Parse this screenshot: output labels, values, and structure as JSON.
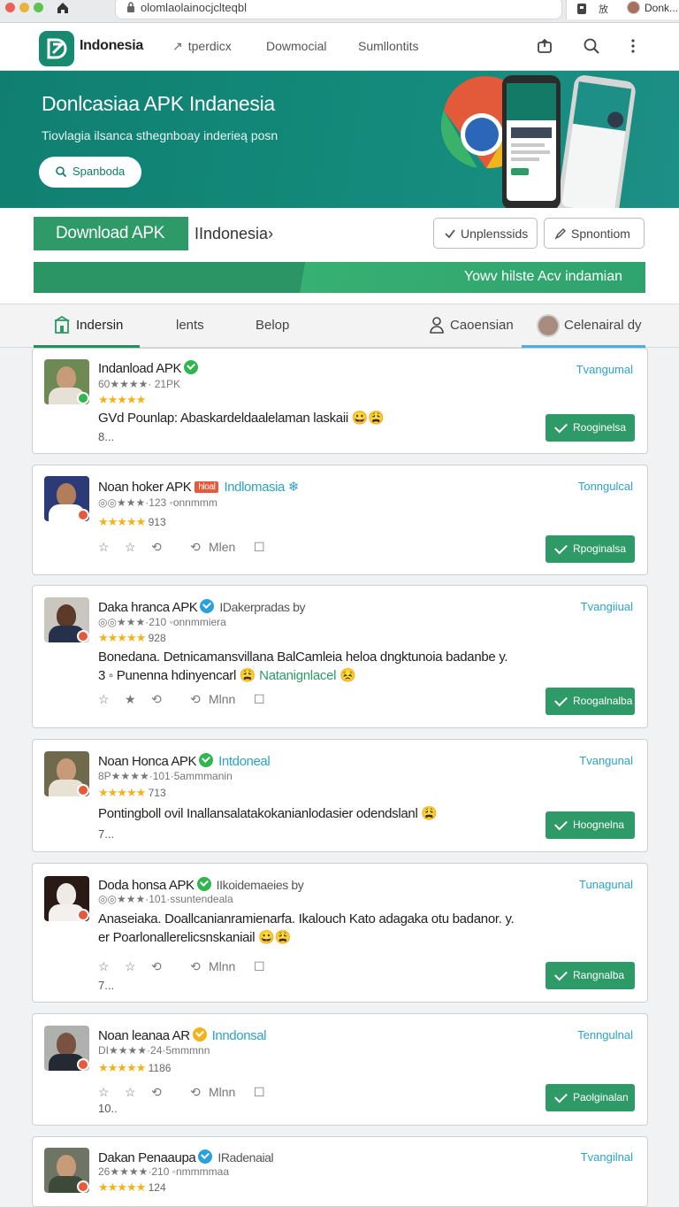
{
  "browser": {
    "url": "olomlaolainocjclteqbl",
    "profile_name": "Donk..."
  },
  "header": {
    "brand": "Indonesia",
    "nav": [
      "tperdicx",
      "Dowmocial",
      "Sumllontits"
    ]
  },
  "hero": {
    "title": "Donlcasiaa APK Indanesia",
    "subtitle": "Tiovlagia ilsanca sthegnboay inderieą posn",
    "search_label": "Spanboda"
  },
  "download": {
    "button_label": "Download APK",
    "region_label": "IIndonesia›",
    "pill_1": "Unplenssids",
    "pill_2": "Spnontiom",
    "promo_text": "Yowv hilste Acv indamian"
  },
  "tabs": [
    "Indersin",
    "lents",
    "Belop",
    "Caoensian",
    "Celenairal dy"
  ],
  "cards": [
    {
      "title": "Indanload APK",
      "meta": "60★★★★· 21PK",
      "rating_stars": "★★★★★",
      "desc": "GVd Pounlap: Abaskardeldaalelaman laskaii 😀😩",
      "small": "8...",
      "status": "Tvangumal",
      "button": "Rooginelsa"
    },
    {
      "title": "Noan hoker APK",
      "tag": "hloal",
      "link": "Indlomasia ❄",
      "meta": "◎◎★★★·123 ◦onnmmm",
      "rating_stars": "★★★★★",
      "rating_value": "913",
      "actions": [
        "☆",
        "☆",
        "⟲",
        "⟲",
        "Mlen",
        "☐"
      ],
      "status": "Tonngulcal",
      "button": "Rpoginalsa"
    },
    {
      "title": "Daka hranca APK",
      "muted": "IDakerpradas by",
      "meta": "◎◎★★★·210 ◦onnmmiera",
      "rating_stars": "★★★★★",
      "rating_value": "928",
      "desc": "Bonedana. Detnicamansvillana BalCamleia heloa dngktunoia badanbe y.",
      "desc2": "3 ◦ Punenna hdinyencarl 😩",
      "desc2_link": "Natanignlacel 😣",
      "actions": [
        "☆",
        "★",
        "⟲",
        "⟲",
        "Mlnn",
        "☐"
      ],
      "status": "Tvangiiual",
      "button": "Roogalnalba"
    },
    {
      "title": "Noan Honca APK",
      "link": "Intdoneal",
      "meta": "8P★★★★·101·5ammmanin",
      "rating_stars": "★★★★★",
      "rating_value": "713",
      "desc": "Pontingboll ovil Inallansalatakokanianlodasier odendslanl 😩",
      "small": "7...",
      "status": "Tvangunal",
      "button": "Hoognelna"
    },
    {
      "title": "Doda honsa APK",
      "muted": "IIkoidemaeies by",
      "meta": "◎◎★★★·101·ssuntendeala",
      "desc": "Anaseiaka. Doallcanianramienarfa. Ikalouch Kato adagaka otu badanor. y.",
      "desc2": "er Poarlonallerelicsnskaniail 😀😩",
      "actions": [
        "☆",
        "☆",
        "⟲",
        "⟲",
        "Mlnn",
        "☐"
      ],
      "small": "7...",
      "status": "Tunagunal",
      "button": "Rangnalba"
    },
    {
      "title": "Noan leanaa AR",
      "link": "Inndonsal",
      "meta": "DI★★★★·24·5mmmnn",
      "rating_stars": "★★★★★",
      "rating_value": "1186",
      "actions": [
        "☆",
        "☆",
        "⟲",
        "⟲",
        "Mlnn",
        "☐"
      ],
      "small": "10..",
      "status": "Tenngulnal",
      "button": "Paolginalan"
    },
    {
      "title": "Dakan Penaaupa",
      "muted": "IRadenaial",
      "meta": "26★★★★·210 ◦nmmmmaa",
      "rating_stars": "★★★★★",
      "rating_value": "124",
      "status": "Tvangilnal"
    }
  ],
  "colors": {
    "brand_green": "#2e9a67",
    "hero_teal": "#138a7b",
    "link_blue": "#2ba3c9",
    "star_gold": "#f2b21c"
  }
}
